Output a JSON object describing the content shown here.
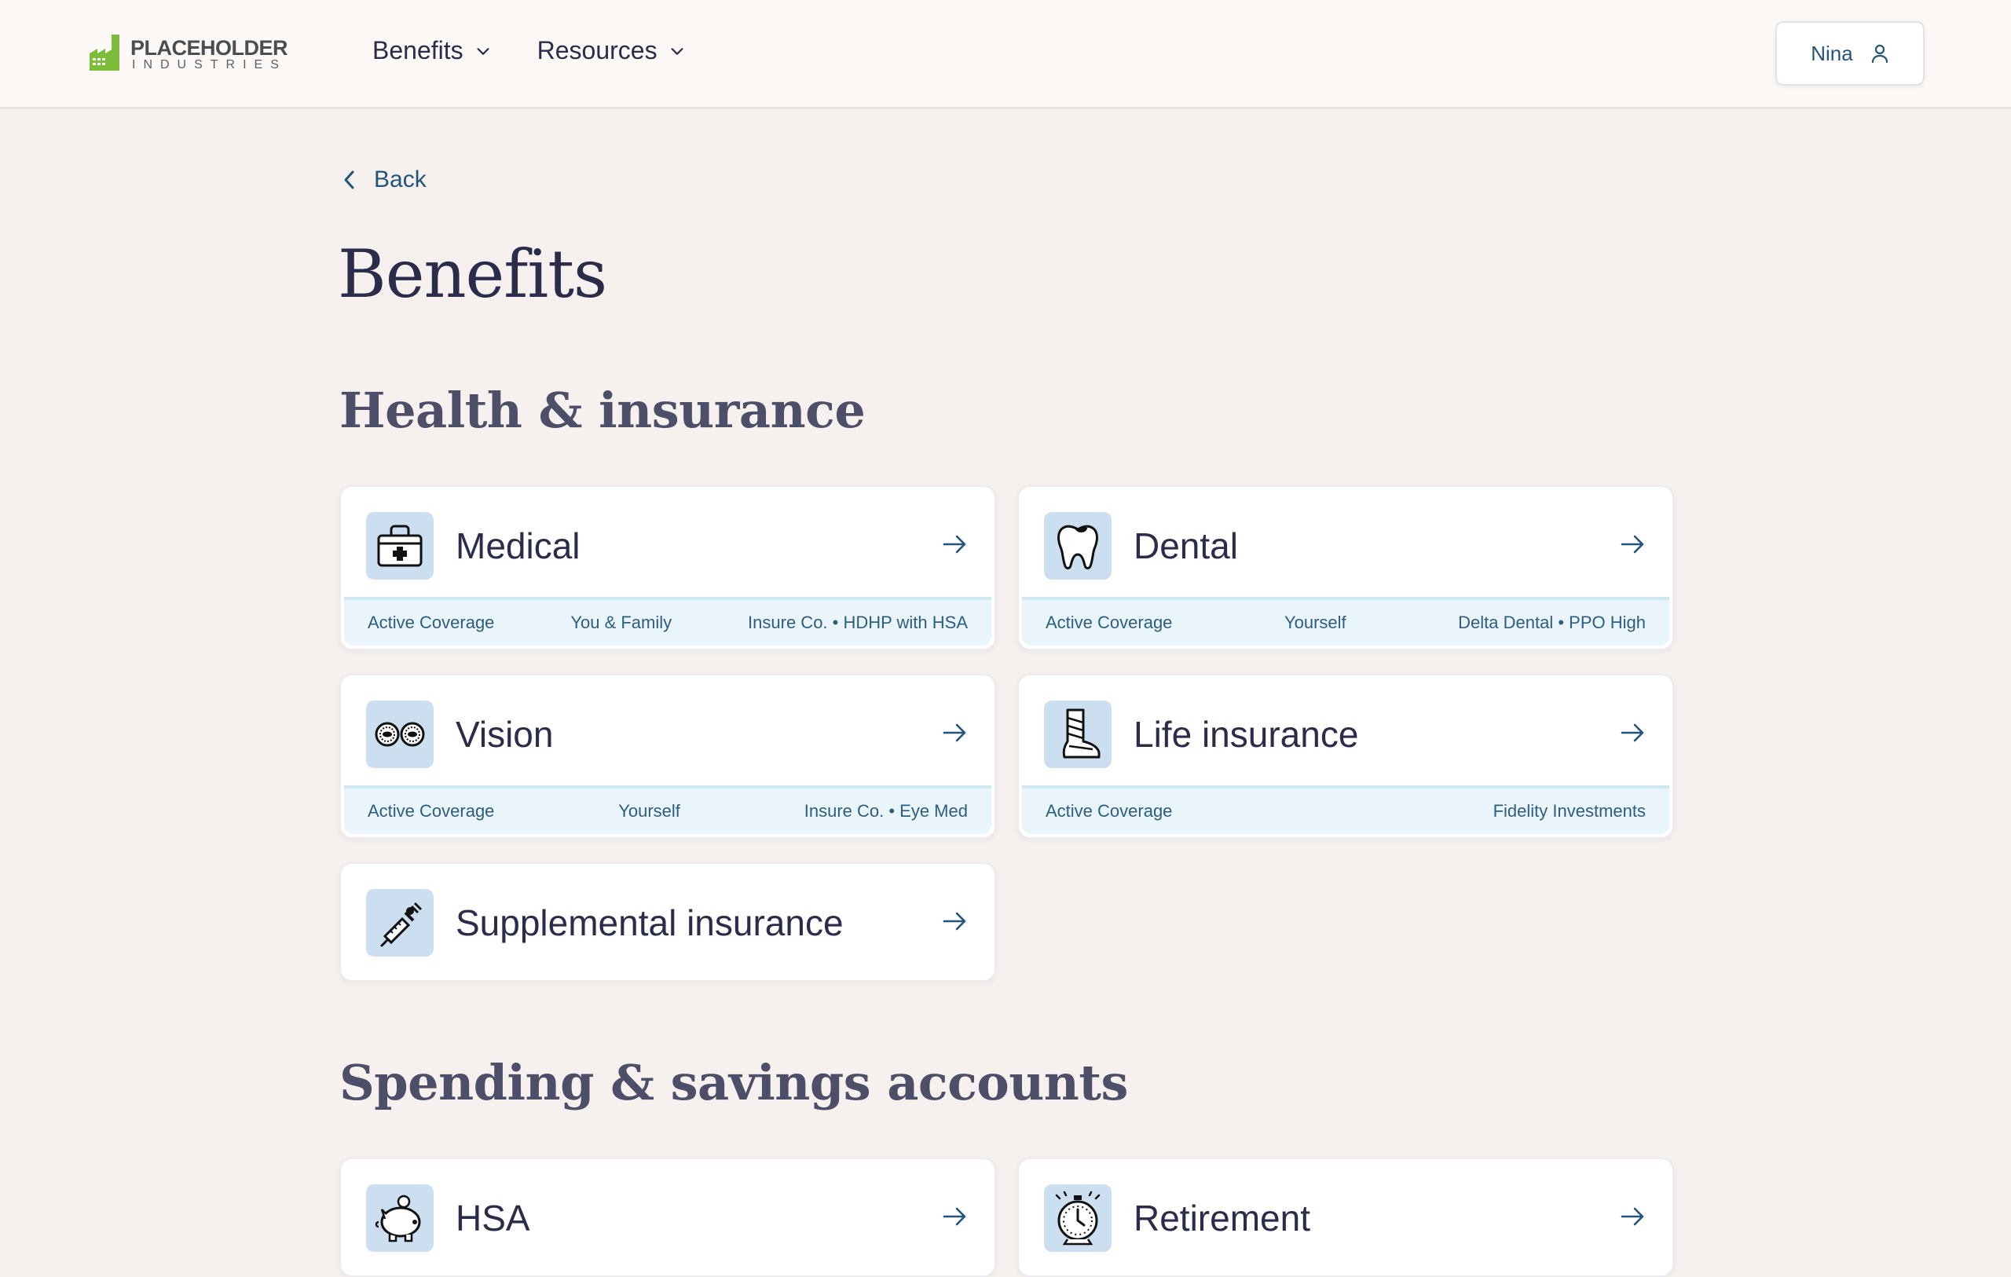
{
  "header": {
    "logo_line1": "PLACEHOLDER",
    "logo_line2": "INDUSTRIES",
    "nav": [
      {
        "label": "Benefits",
        "icon": "chevron-down-icon"
      },
      {
        "label": "Resources",
        "icon": "chevron-down-icon"
      }
    ],
    "user": {
      "name": "Nina",
      "icon": "user-icon"
    }
  },
  "back_label": "Back",
  "page_title": "Benefits",
  "sections": {
    "health": "Health & insurance",
    "spending": "Spending & savings accounts"
  },
  "cards": {
    "medical": {
      "title": "Medical",
      "icon": "first-aid-kit-icon",
      "status": "Active Coverage",
      "covered": "You & Family",
      "plan": "Insure Co. • HDHP with HSA"
    },
    "dental": {
      "title": "Dental",
      "icon": "tooth-icon",
      "status": "Active Coverage",
      "covered": "Yourself",
      "plan": "Delta Dental • PPO High"
    },
    "vision": {
      "title": "Vision",
      "icon": "eyes-icon",
      "status": "Active Coverage",
      "covered": "Yourself",
      "plan": "Insure Co. • Eye Med"
    },
    "life": {
      "title": "Life insurance",
      "icon": "leg-cast-icon",
      "status": "Active Coverage",
      "plan": "Fidelity Investments"
    },
    "supplemental": {
      "title": "Supplemental insurance",
      "icon": "syringe-icon"
    },
    "hsa": {
      "title": "HSA",
      "icon": "piggy-bank-icon"
    },
    "retirement": {
      "title": "Retirement",
      "icon": "stopwatch-icon"
    }
  },
  "colors": {
    "background": "#f6f1ee",
    "accent": "#22557a",
    "icon_tile": "#cbdff1",
    "card_footer": "#eaf4fb",
    "logo_green": "#7cbd3c"
  }
}
